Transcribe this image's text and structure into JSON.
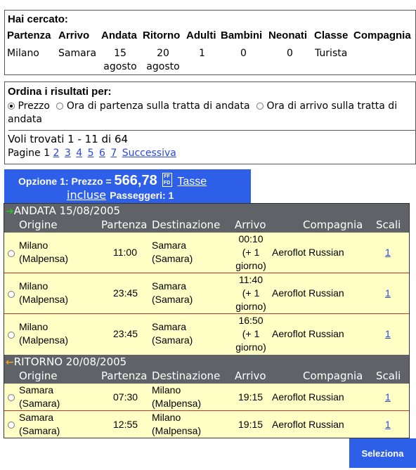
{
  "search": {
    "title": "Hai cercato:",
    "headers": [
      "Partenza",
      "Arrivo",
      "Andata",
      "Ritorno",
      "Adulti",
      "Bambini",
      "Neonati",
      "Classe",
      "Compagnia"
    ],
    "values": {
      "partenza": "Milano",
      "arrivo": "Samara",
      "andata_1": "15",
      "andata_2": "agosto",
      "ritorno_1": "20",
      "ritorno_2": "agosto",
      "adulti": "1",
      "bambini": "0",
      "neonati": "0",
      "classe": "Turista"
    }
  },
  "sort": {
    "title": "Ordina i risultati per:",
    "options": [
      "Prezzo",
      "Ora di partenza sulla tratta di andata",
      "Ora di arrivo sulla tratta di andata"
    ],
    "selected": "Prezzo"
  },
  "results": {
    "found": "Voli trovati 1 - 11 di 64",
    "pages_label": "Pagine 1",
    "pages": [
      "2",
      "3",
      "4",
      "5",
      "6",
      "7"
    ],
    "next": "Successiva"
  },
  "option": {
    "label": "Opzione 1: Prezzo =",
    "price": "566,78",
    "currency_top": "FF",
    "currency_bottom": "FD",
    "tasse_1": "Tasse",
    "tasse_2": "incluse",
    "passengers": "Passeggeri: 1"
  },
  "columns": [
    "Origine",
    "Partenza",
    "Destinazione",
    "Arrivo",
    "Compagnia",
    "Scali"
  ],
  "outbound": {
    "label": "ANDATA  15/08/2005",
    "arrow_color": "#22c422",
    "flights": [
      {
        "origin_1": "Milano",
        "origin_2": "(Malpensa)",
        "dep": "11:00",
        "dest_1": "Samara",
        "dest_2": "(Samara)",
        "arr_1": "00:10",
        "arr_2": "(+ 1",
        "arr_3": "giorno)",
        "airline": "Aeroflot Russian",
        "stops": "1"
      },
      {
        "origin_1": "Milano",
        "origin_2": "(Malpensa)",
        "dep": "23:45",
        "dest_1": "Samara",
        "dest_2": "(Samara)",
        "arr_1": "11:40",
        "arr_2": "(+ 1",
        "arr_3": "giorno)",
        "airline": "Aeroflot Russian",
        "stops": "1"
      },
      {
        "origin_1": "Milano",
        "origin_2": "(Malpensa)",
        "dep": "23:45",
        "dest_1": "Samara",
        "dest_2": "(Samara)",
        "arr_1": "16:50",
        "arr_2": "(+ 1",
        "arr_3": "giorno)",
        "airline": "Aeroflot Russian",
        "stops": "1"
      }
    ]
  },
  "return": {
    "label": "RITORNO  20/08/2005",
    "arrow_color": "#f0a020",
    "flights": [
      {
        "origin_1": "Samara",
        "origin_2": "(Samara)",
        "dep": "07:30",
        "dest_1": "Milano",
        "dest_2": "(Malpensa)",
        "arr_1": "19:15",
        "airline": "Aeroflot Russian",
        "stops": "1"
      },
      {
        "origin_1": "Samara",
        "origin_2": "(Samara)",
        "dep": "12:55",
        "dest_1": "Milano",
        "dest_2": "(Malpensa)",
        "arr_1": "19:15",
        "airline": "Aeroflot Russian",
        "stops": "1"
      }
    ]
  },
  "select_button": "Seleziona"
}
